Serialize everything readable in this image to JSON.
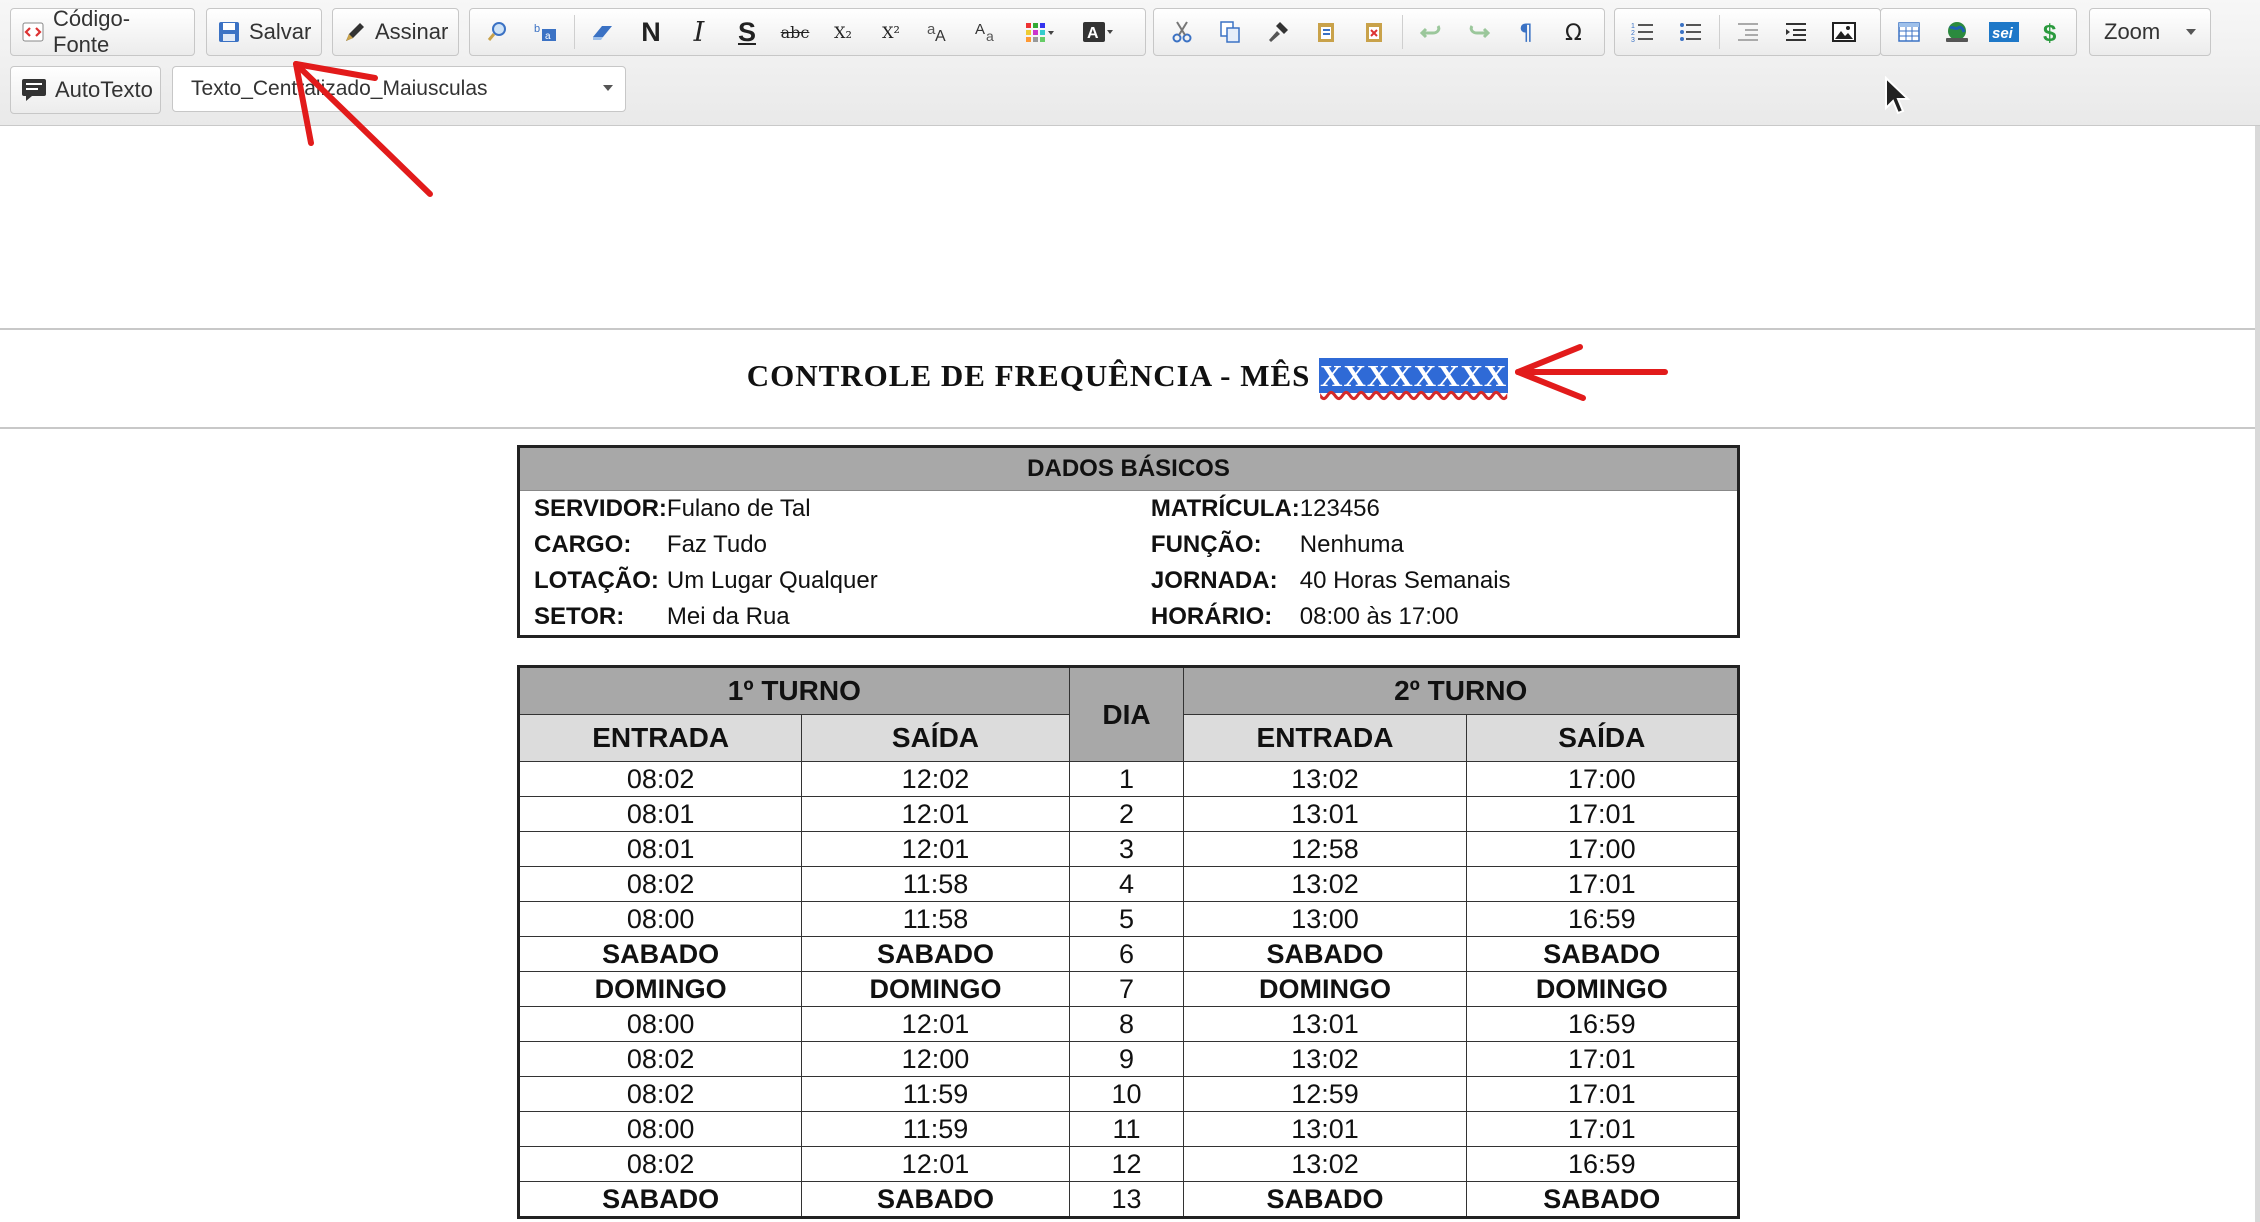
{
  "toolbar": {
    "codigo_fonte_label": "Código-Fonte",
    "salvar_label": "Salvar",
    "assinar_label": "Assinar",
    "bold_glyph": "N",
    "italic_glyph": "I",
    "strike_glyph": "S",
    "abc_glyph": "abc",
    "subscript_glyph": "X₂",
    "superscript_glyph": "X²",
    "autotexto_label": "AutoTexto",
    "style_value": "Texto_Centralizado_Maiusculas",
    "zoom_label": "Zoom",
    "sei_label": "sei",
    "accent_color": "#1e78c8"
  },
  "document": {
    "title_prefix": "CONTROLE DE FREQUÊNCIA - MÊS ",
    "title_selected": "XXXXXXXX",
    "basic": {
      "header": "DADOS BÁSICOS",
      "rows": [
        {
          "k1": "SERVIDOR:",
          "v1": "Fulano de Tal",
          "k2": "MATRÍCULA:",
          "v2": "123456"
        },
        {
          "k1": "CARGO:",
          "v1": "Faz Tudo",
          "k2": "FUNÇÃO:",
          "v2": "Nenhuma"
        },
        {
          "k1": "LOTAÇÃO:",
          "v1": "Um Lugar Qualquer",
          "k2": "JORNADA:",
          "v2": "40 Horas Semanais"
        },
        {
          "k1": "SETOR:",
          "v1": "Mei da Rua",
          "k2": "HORÁRIO:",
          "v2": "08:00 às 17:00"
        }
      ]
    },
    "freq": {
      "turno1": "1º TURNO",
      "dia": "DIA",
      "turno2": "2º TURNO",
      "entrada": "ENTRADA",
      "saida": "SAÍDA",
      "rows": [
        [
          "08:02",
          "12:02",
          "1",
          "13:02",
          "17:00"
        ],
        [
          "08:01",
          "12:01",
          "2",
          "13:01",
          "17:01"
        ],
        [
          "08:01",
          "12:01",
          "3",
          "12:58",
          "17:00"
        ],
        [
          "08:02",
          "11:58",
          "4",
          "13:02",
          "17:01"
        ],
        [
          "08:00",
          "11:58",
          "5",
          "13:00",
          "16:59"
        ],
        [
          "SABADO",
          "SABADO",
          "6",
          "SABADO",
          "SABADO"
        ],
        [
          "DOMINGO",
          "DOMINGO",
          "7",
          "DOMINGO",
          "DOMINGO"
        ],
        [
          "08:00",
          "12:01",
          "8",
          "13:01",
          "16:59"
        ],
        [
          "08:02",
          "12:00",
          "9",
          "13:02",
          "17:01"
        ],
        [
          "08:02",
          "11:59",
          "10",
          "12:59",
          "17:01"
        ],
        [
          "08:00",
          "11:59",
          "11",
          "13:01",
          "17:01"
        ],
        [
          "08:02",
          "12:01",
          "12",
          "13:02",
          "16:59"
        ],
        [
          "SABADO",
          "SABADO",
          "13",
          "SABADO",
          "SABADO"
        ]
      ]
    }
  },
  "annotation_color": "#e21b1b"
}
